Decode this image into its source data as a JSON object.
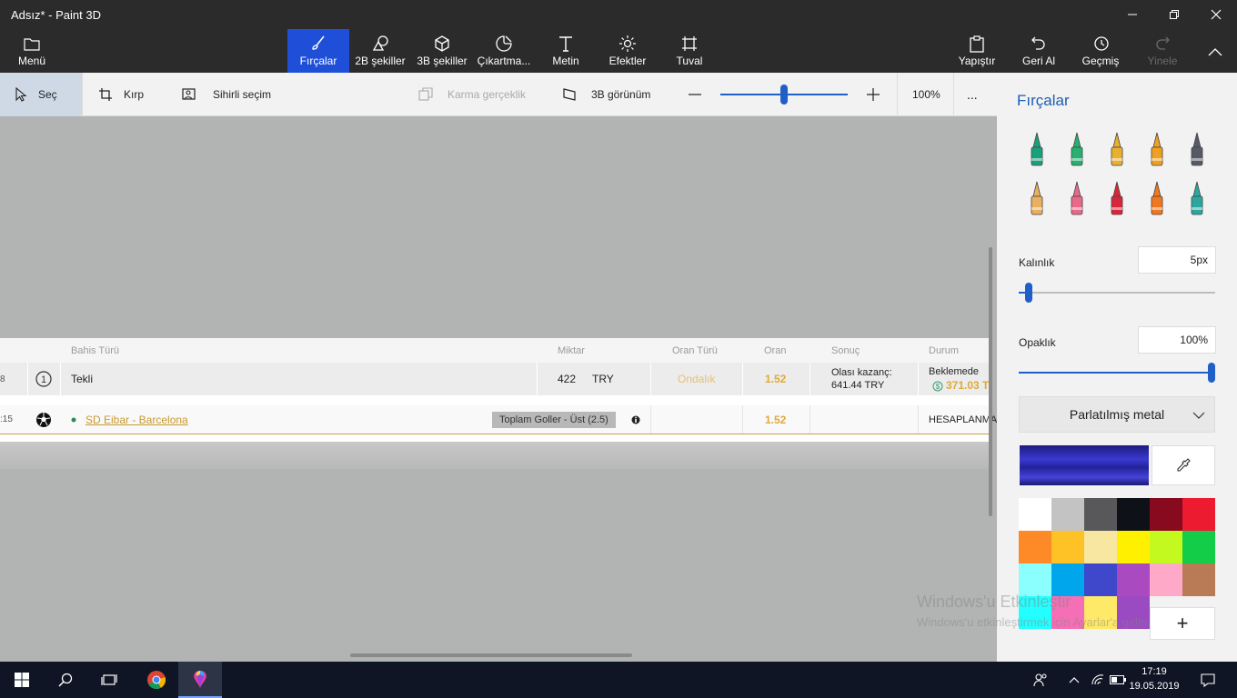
{
  "window": {
    "title": "Adsız* - Paint 3D",
    "minimize_icon": "minimize-icon",
    "maximize_icon": "restore-icon",
    "close_icon": "close-icon"
  },
  "ribbon": {
    "menu": "Menü",
    "tools": [
      {
        "label": "Fırçalar",
        "icon": "brush-icon"
      },
      {
        "label": "2B şekiller",
        "icon": "2d-shapes-icon"
      },
      {
        "label": "3B şekiller",
        "icon": "3d-shapes-icon"
      },
      {
        "label": "Çıkartma...",
        "icon": "sticker-icon"
      },
      {
        "label": "Metin",
        "icon": "text-icon"
      },
      {
        "label": "Efektler",
        "icon": "effects-icon"
      },
      {
        "label": "Tuval",
        "icon": "canvas-icon"
      }
    ],
    "right": [
      {
        "label": "Yapıştır",
        "icon": "paste-icon"
      },
      {
        "label": "Geri Al",
        "icon": "undo-icon"
      },
      {
        "label": "Geçmiş",
        "icon": "history-icon"
      },
      {
        "label": "Yinele",
        "icon": "redo-icon"
      }
    ]
  },
  "toolbar": {
    "select": "Seç",
    "crop": "Kırp",
    "magic_select": "Sihirli seçim",
    "mixed_reality": "Karma gerçeklik",
    "view_3d": "3B görünüm",
    "zoom": "100%",
    "zoom_level": 0.5,
    "more": "..."
  },
  "canvas": {
    "headers": {
      "bet_type": "Bahis Türü",
      "amount": "Miktar",
      "odds_type": "Oran Türü",
      "odds": "Oran",
      "result": "Sonuç",
      "status": "Durum"
    },
    "row1": {
      "left_num": "8",
      "icon_num": "1",
      "bet_type": "Tekli",
      "amount": "422",
      "currency": "TRY",
      "odds_type": "Ondalık",
      "odds": "1.52",
      "result_label": "Olası kazanç:",
      "result_value": "641.44 TRY",
      "status": "Beklemede",
      "status_amount": "371.03 T"
    },
    "row2": {
      "left_time": ":15",
      "match": "SD Eibar - Barcelona",
      "market": "Toplam Goller - Üst (2.5)",
      "odds": "1.52",
      "status": "HESAPLANMA"
    }
  },
  "panel": {
    "title": "Fırçalar",
    "brushes": [
      {
        "name": "marker-icon",
        "color": "#1aa07a"
      },
      {
        "name": "calligraphy-pen-icon",
        "color": "#28b070"
      },
      {
        "name": "oil-brush-icon",
        "color": "#e8b030"
      },
      {
        "name": "watercolor-icon",
        "color": "#f0a020"
      },
      {
        "name": "pixel-pen-icon",
        "color": "#555a66"
      },
      {
        "name": "pencil-icon",
        "color": "#e8b060"
      },
      {
        "name": "eraser-icon",
        "color": "#e86a8a"
      },
      {
        "name": "crayon-icon",
        "color": "#d8263a"
      },
      {
        "name": "spray-can-icon",
        "color": "#f07820"
      },
      {
        "name": "fill-icon",
        "color": "#2aa8a0"
      }
    ],
    "thickness_label": "Kalınlık",
    "thickness_value": "5px",
    "thickness_level": 0.05,
    "opacity_label": "Opaklık",
    "opacity_value": "100%",
    "opacity_level": 1.0,
    "material": "Parlatılmış metal",
    "current_color": "#2b2bb8",
    "palette": [
      "#ffffff",
      "#c3c3c3",
      "#58585a",
      "#0e1117",
      "#870a1e",
      "#ec1b30",
      "#fd8927",
      "#fec226",
      "#f7e7a1",
      "#fff000",
      "#c3f91e",
      "#13cc48",
      "#8afffe",
      "#00a6eb",
      "#3f47cb",
      "#a94ac0",
      "#fda9c7",
      "#b97a56",
      "#23ffff",
      "#f46fb5",
      "#ffe968",
      "#9a4bc1"
    ],
    "add_color": "+"
  },
  "watermark": {
    "line1": "Windows'u Etkinleştir",
    "line2": "Windows'u etkinleştirmek için Ayarlar'a gidin."
  },
  "taskbar": {
    "time": "17:19",
    "date": "19.05.2019"
  }
}
